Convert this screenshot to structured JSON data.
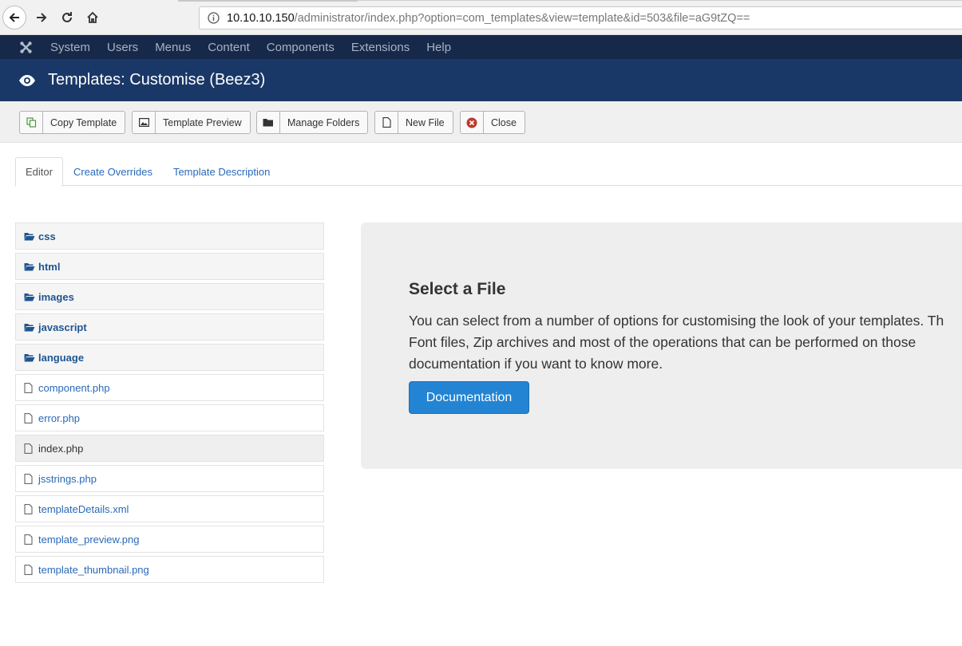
{
  "browser": {
    "url_host": "10.10.10.150",
    "url_path": "/administrator/index.php?option=com_templates&view=template&id=503&file=aG9tZQ=="
  },
  "topnav": {
    "items": [
      "System",
      "Users",
      "Menus",
      "Content",
      "Components",
      "Extensions",
      "Help"
    ]
  },
  "header": {
    "title": "Templates: Customise (Beez3)"
  },
  "toolbar": {
    "copy_template": "Copy Template",
    "template_preview": "Template Preview",
    "manage_folders": "Manage Folders",
    "new_file": "New File",
    "close": "Close"
  },
  "tabs": [
    "Editor",
    "Create Overrides",
    "Template Description"
  ],
  "tree": {
    "folders": [
      "css",
      "html",
      "images",
      "javascript",
      "language"
    ],
    "files": [
      "component.php",
      "error.php",
      "index.php",
      "jsstrings.php",
      "templateDetails.xml",
      "template_preview.png",
      "template_thumbnail.png"
    ],
    "selected_file": "index.php"
  },
  "hero": {
    "title": "Select a File",
    "description": "You can select from a number of options for customising the look of your templates. Th\nFont files, Zip archives and most of the operations that can be performed on those\ndocumentation if you want to know more.",
    "button": "Documentation"
  },
  "colors": {
    "topnav_bg": "#17294a",
    "header_bg": "#1a3867",
    "link": "#2a69b8",
    "primary_button": "#2384d3",
    "close_icon": "#c0392b"
  }
}
